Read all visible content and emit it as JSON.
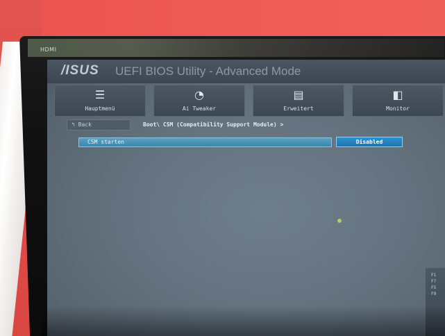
{
  "monitor": {
    "port_label": "HDMI"
  },
  "bios": {
    "logo": "/ISUS",
    "title": "UEFI BIOS Utility - Advanced Mode",
    "tabs": [
      {
        "label": "Hauptmenü",
        "icon": "list-icon",
        "glyph": "☰"
      },
      {
        "label": "Ai Tweaker",
        "icon": "tweaker-icon",
        "glyph": "◔"
      },
      {
        "label": "Erweitert",
        "icon": "advanced-icon",
        "glyph": "▤"
      },
      {
        "label": "Monitor",
        "icon": "monitor-icon",
        "glyph": "◧"
      }
    ],
    "back_label": "↰ Back",
    "breadcrumb": "Boot\\ CSM (Compatibility Support Module) >",
    "setting": {
      "label": "CSM starten",
      "value": "Disabled"
    },
    "right_panel_text": "F1\nF7\nF5\nF9"
  }
}
